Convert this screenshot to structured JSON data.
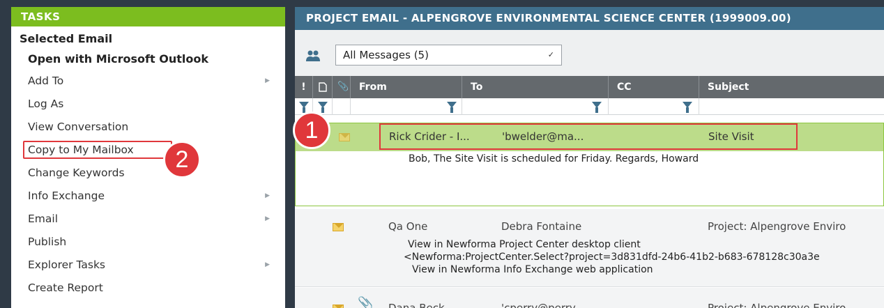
{
  "tasks": {
    "header": "TASKS",
    "section": "Selected Email",
    "items": [
      {
        "label": "Open with Microsoft Outlook",
        "submenu": false,
        "bold": true
      },
      {
        "label": "Add To",
        "submenu": true
      },
      {
        "label": "Log As",
        "submenu": false
      },
      {
        "label": "View Conversation",
        "submenu": false
      },
      {
        "label": "Copy to My Mailbox",
        "submenu": false,
        "highlighted": true
      },
      {
        "label": "Change Keywords",
        "submenu": false
      },
      {
        "label": "Info Exchange",
        "submenu": true
      },
      {
        "label": "Email",
        "submenu": true
      },
      {
        "label": "Publish",
        "submenu": false
      },
      {
        "label": "Explorer Tasks",
        "submenu": true
      },
      {
        "label": "Create Report",
        "submenu": false
      }
    ]
  },
  "email": {
    "header": "PROJECT EMAIL - ALPENGROVE ENVIRONMENTAL SCIENCE CENTER (1999009.00)",
    "view_select": "All Messages (5)",
    "columns": [
      "!",
      "",
      "",
      "From",
      "To",
      "CC",
      "Subject"
    ],
    "rows": [
      {
        "from": "Rick Crider - I...",
        "to": "'bwelder@ma...",
        "cc": "",
        "subject": "Site  Visit",
        "attachment": false,
        "selected": true,
        "preview": [
          "Bob,    The Site Visit is scheduled for Friday.    Regards,    Howard"
        ]
      },
      {
        "from": "Qa One",
        "to": "Debra Fontaine",
        "cc": "",
        "subject": "Project: Alpengrove Enviro",
        "attachment": false,
        "selected": false,
        "preview": [
          "View in Newforma Project Center desktop client",
          "<Newforma:ProjectCenter.Select?project=3d831dfd-24b6-41b2-b683-678128c30a3e",
          "View in Newforma Info Exchange web application"
        ]
      },
      {
        "from": "Dana Beck",
        "to": "'cperry@perry...",
        "cc": "",
        "subject": "Project: Alpengrove Enviro",
        "attachment": true,
        "selected": false,
        "preview": []
      }
    ]
  },
  "callouts": {
    "one": "1",
    "two": "2"
  },
  "colors": {
    "tasks_header": "#7cbd1f",
    "email_header": "#3f6f8c",
    "selected_row": "#bcdc8a",
    "callout": "#e0373b"
  }
}
